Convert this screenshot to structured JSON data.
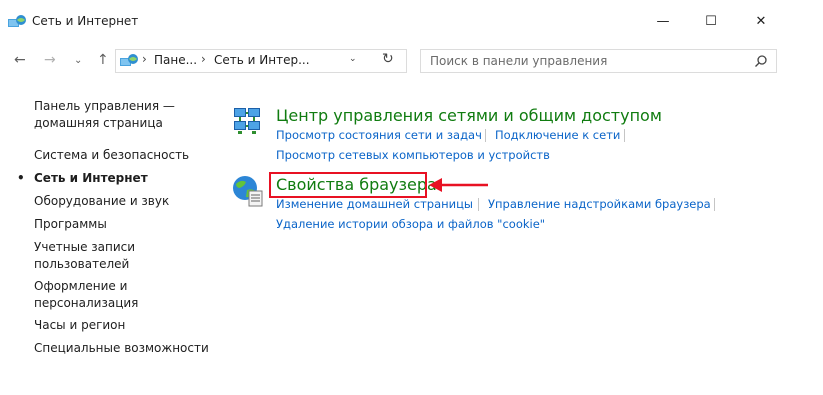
{
  "window": {
    "title": "Сеть и Интернет",
    "controls": {
      "minimize": "—",
      "maximize": "☐",
      "close": "✕"
    }
  },
  "nav": {
    "back": "←",
    "forward": "→",
    "recent": "⌄",
    "up": "↑"
  },
  "address": {
    "separator": "›",
    "crumbs": [
      "Пане...",
      "Сеть и Интер..."
    ],
    "dropdown": "⌄",
    "refresh": "↻"
  },
  "search": {
    "placeholder": "Поиск в панели управления"
  },
  "sidebar": {
    "items": [
      {
        "label_lines": [
          "Панель управления —",
          "домашняя страница"
        ]
      },
      {
        "label": "Система и безопасность"
      },
      {
        "label": "Сеть и Интернет",
        "active": true,
        "bullet": "•"
      },
      {
        "label": "Оборудование и звук"
      },
      {
        "label": "Программы"
      },
      {
        "label_lines": [
          "Учетные записи",
          "пользователей"
        ]
      },
      {
        "label_lines": [
          "Оформление и",
          "персонализация"
        ]
      },
      {
        "label": "Часы и регион"
      },
      {
        "label": "Специальные возможности"
      }
    ]
  },
  "categories": [
    {
      "title": "Центр управления сетями и общим доступом",
      "links": [
        "Просмотр состояния сети и задач",
        "Подключение к сети",
        "Просмотр сетевых компьютеров и устройств"
      ]
    },
    {
      "title": "Свойства браузера",
      "links": [
        "Изменение домашней страницы",
        "Управление надстройками браузера",
        "Удаление истории обзора и файлов \"cookie\""
      ]
    }
  ],
  "colors": {
    "accent_green": "#107c10",
    "link_blue": "#0a64c8",
    "highlight_red": "#e81123"
  }
}
